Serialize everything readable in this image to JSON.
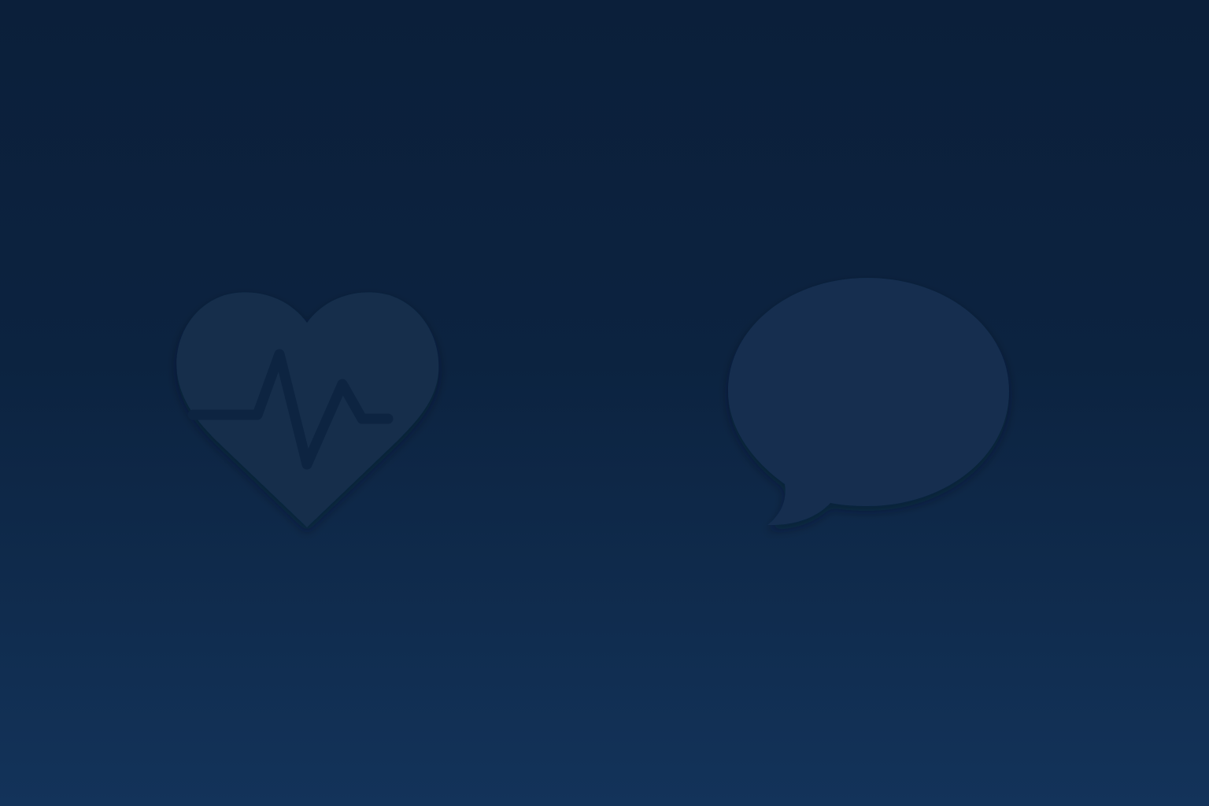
{
  "icons": [
    {
      "name": "heart-pulse-icon",
      "color": "#122e4c",
      "line_color": "#0d2441"
    },
    {
      "name": "speech-bubble-icon",
      "color": "#132f4f"
    }
  ],
  "background": {
    "top_color": "#0b1f3a",
    "bottom_color": "#13335a"
  }
}
